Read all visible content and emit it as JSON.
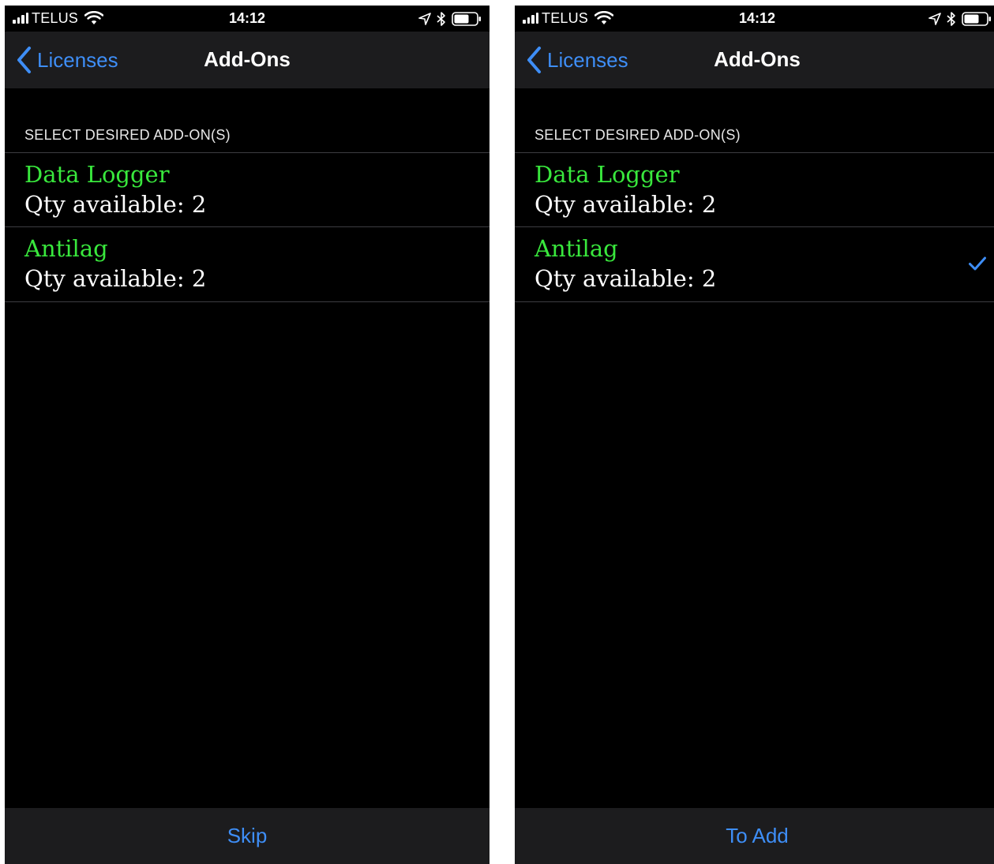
{
  "colors": {
    "accent": "#3e8ef7",
    "item_title": "#39e83d",
    "background": "#000000",
    "bar_background": "#1c1c1e"
  },
  "screens": [
    {
      "status": {
        "carrier": "TELUS",
        "time": "14:12"
      },
      "nav": {
        "back_label": "Licenses",
        "title": "Add-Ons"
      },
      "section_header": "SELECT DESIRED ADD-ON(S)",
      "items": [
        {
          "title": "Data Logger",
          "subtitle": "Qty available: 2",
          "selected": false
        },
        {
          "title": "Antilag",
          "subtitle": "Qty available: 2",
          "selected": false
        }
      ],
      "bottom_button": "Skip"
    },
    {
      "status": {
        "carrier": "TELUS",
        "time": "14:12"
      },
      "nav": {
        "back_label": "Licenses",
        "title": "Add-Ons"
      },
      "section_header": "SELECT DESIRED ADD-ON(S)",
      "items": [
        {
          "title": "Data Logger",
          "subtitle": "Qty available: 2",
          "selected": false
        },
        {
          "title": "Antilag",
          "subtitle": "Qty available: 2",
          "selected": true
        }
      ],
      "bottom_button": "To Add"
    }
  ],
  "icons": {
    "signal": "signal-bars-icon",
    "wifi": "wifi-icon",
    "location": "location-arrow-icon",
    "bluetooth": "bluetooth-icon",
    "battery": "battery-icon",
    "back": "chevron-left-icon",
    "check": "checkmark-icon"
  }
}
